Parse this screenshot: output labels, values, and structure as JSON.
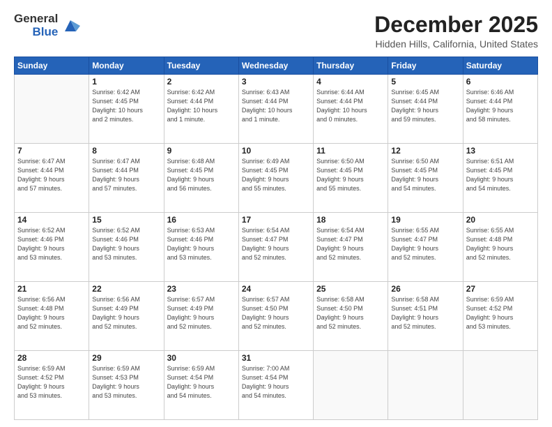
{
  "header": {
    "logo_line1": "General",
    "logo_line2": "Blue",
    "month": "December 2025",
    "location": "Hidden Hills, California, United States"
  },
  "weekdays": [
    "Sunday",
    "Monday",
    "Tuesday",
    "Wednesday",
    "Thursday",
    "Friday",
    "Saturday"
  ],
  "weeks": [
    [
      {
        "day": "",
        "info": ""
      },
      {
        "day": "1",
        "info": "Sunrise: 6:42 AM\nSunset: 4:45 PM\nDaylight: 10 hours\nand 2 minutes."
      },
      {
        "day": "2",
        "info": "Sunrise: 6:42 AM\nSunset: 4:44 PM\nDaylight: 10 hours\nand 1 minute."
      },
      {
        "day": "3",
        "info": "Sunrise: 6:43 AM\nSunset: 4:44 PM\nDaylight: 10 hours\nand 1 minute."
      },
      {
        "day": "4",
        "info": "Sunrise: 6:44 AM\nSunset: 4:44 PM\nDaylight: 10 hours\nand 0 minutes."
      },
      {
        "day": "5",
        "info": "Sunrise: 6:45 AM\nSunset: 4:44 PM\nDaylight: 9 hours\nand 59 minutes."
      },
      {
        "day": "6",
        "info": "Sunrise: 6:46 AM\nSunset: 4:44 PM\nDaylight: 9 hours\nand 58 minutes."
      }
    ],
    [
      {
        "day": "7",
        "info": "Sunrise: 6:47 AM\nSunset: 4:44 PM\nDaylight: 9 hours\nand 57 minutes."
      },
      {
        "day": "8",
        "info": "Sunrise: 6:47 AM\nSunset: 4:44 PM\nDaylight: 9 hours\nand 57 minutes."
      },
      {
        "day": "9",
        "info": "Sunrise: 6:48 AM\nSunset: 4:45 PM\nDaylight: 9 hours\nand 56 minutes."
      },
      {
        "day": "10",
        "info": "Sunrise: 6:49 AM\nSunset: 4:45 PM\nDaylight: 9 hours\nand 55 minutes."
      },
      {
        "day": "11",
        "info": "Sunrise: 6:50 AM\nSunset: 4:45 PM\nDaylight: 9 hours\nand 55 minutes."
      },
      {
        "day": "12",
        "info": "Sunrise: 6:50 AM\nSunset: 4:45 PM\nDaylight: 9 hours\nand 54 minutes."
      },
      {
        "day": "13",
        "info": "Sunrise: 6:51 AM\nSunset: 4:45 PM\nDaylight: 9 hours\nand 54 minutes."
      }
    ],
    [
      {
        "day": "14",
        "info": "Sunrise: 6:52 AM\nSunset: 4:46 PM\nDaylight: 9 hours\nand 53 minutes."
      },
      {
        "day": "15",
        "info": "Sunrise: 6:52 AM\nSunset: 4:46 PM\nDaylight: 9 hours\nand 53 minutes."
      },
      {
        "day": "16",
        "info": "Sunrise: 6:53 AM\nSunset: 4:46 PM\nDaylight: 9 hours\nand 53 minutes."
      },
      {
        "day": "17",
        "info": "Sunrise: 6:54 AM\nSunset: 4:47 PM\nDaylight: 9 hours\nand 52 minutes."
      },
      {
        "day": "18",
        "info": "Sunrise: 6:54 AM\nSunset: 4:47 PM\nDaylight: 9 hours\nand 52 minutes."
      },
      {
        "day": "19",
        "info": "Sunrise: 6:55 AM\nSunset: 4:47 PM\nDaylight: 9 hours\nand 52 minutes."
      },
      {
        "day": "20",
        "info": "Sunrise: 6:55 AM\nSunset: 4:48 PM\nDaylight: 9 hours\nand 52 minutes."
      }
    ],
    [
      {
        "day": "21",
        "info": "Sunrise: 6:56 AM\nSunset: 4:48 PM\nDaylight: 9 hours\nand 52 minutes."
      },
      {
        "day": "22",
        "info": "Sunrise: 6:56 AM\nSunset: 4:49 PM\nDaylight: 9 hours\nand 52 minutes."
      },
      {
        "day": "23",
        "info": "Sunrise: 6:57 AM\nSunset: 4:49 PM\nDaylight: 9 hours\nand 52 minutes."
      },
      {
        "day": "24",
        "info": "Sunrise: 6:57 AM\nSunset: 4:50 PM\nDaylight: 9 hours\nand 52 minutes."
      },
      {
        "day": "25",
        "info": "Sunrise: 6:58 AM\nSunset: 4:50 PM\nDaylight: 9 hours\nand 52 minutes."
      },
      {
        "day": "26",
        "info": "Sunrise: 6:58 AM\nSunset: 4:51 PM\nDaylight: 9 hours\nand 52 minutes."
      },
      {
        "day": "27",
        "info": "Sunrise: 6:59 AM\nSunset: 4:52 PM\nDaylight: 9 hours\nand 53 minutes."
      }
    ],
    [
      {
        "day": "28",
        "info": "Sunrise: 6:59 AM\nSunset: 4:52 PM\nDaylight: 9 hours\nand 53 minutes."
      },
      {
        "day": "29",
        "info": "Sunrise: 6:59 AM\nSunset: 4:53 PM\nDaylight: 9 hours\nand 53 minutes."
      },
      {
        "day": "30",
        "info": "Sunrise: 6:59 AM\nSunset: 4:54 PM\nDaylight: 9 hours\nand 54 minutes."
      },
      {
        "day": "31",
        "info": "Sunrise: 7:00 AM\nSunset: 4:54 PM\nDaylight: 9 hours\nand 54 minutes."
      },
      {
        "day": "",
        "info": ""
      },
      {
        "day": "",
        "info": ""
      },
      {
        "day": "",
        "info": ""
      }
    ]
  ]
}
